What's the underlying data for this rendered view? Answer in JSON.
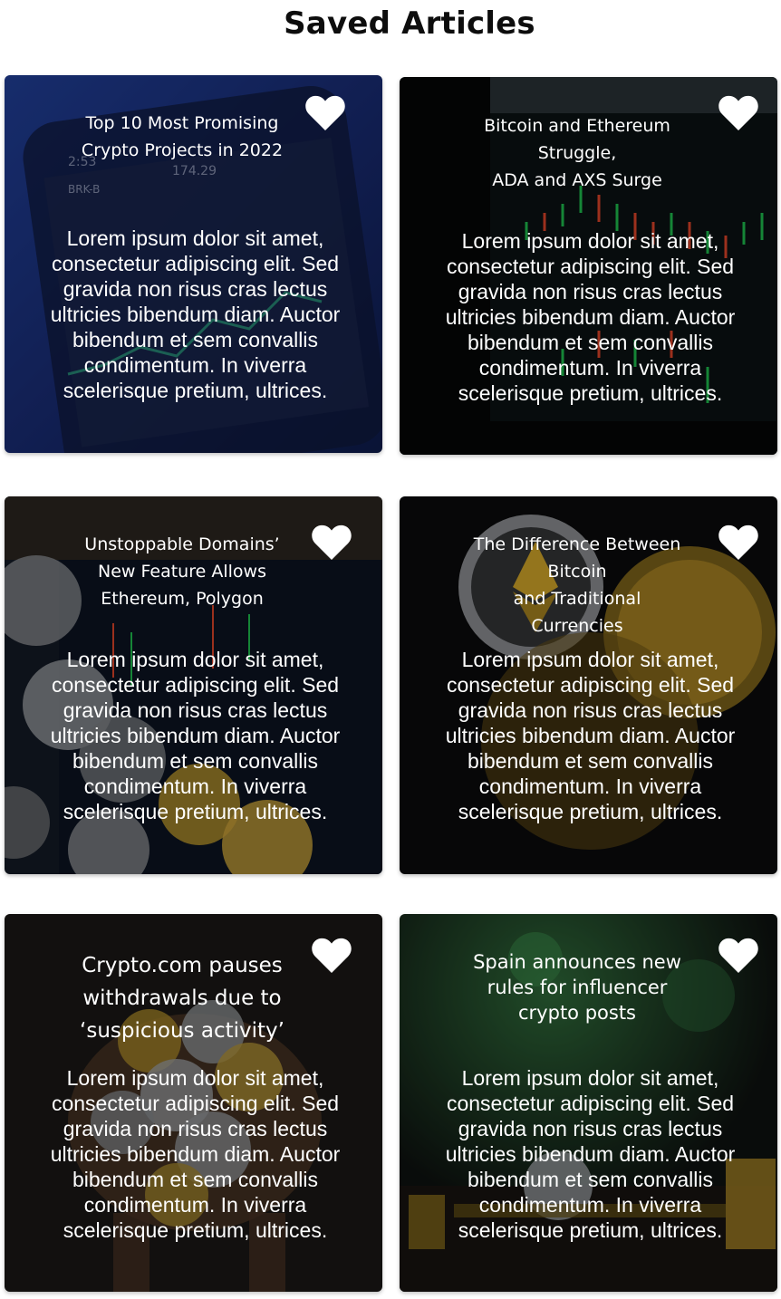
{
  "page": {
    "title": "Saved Articles"
  },
  "articles": [
    {
      "title": "Top 10 Most Promising\nCrypto Projects in 2022",
      "body": "Lorem ipsum dolor sit amet, consectetur adipiscing elit. Sed gravida non risus cras lectus ultricies bibendum diam. Auctor bibendum et sem convallis condimentum. In viverra scelerisque pretium, ultrices.",
      "favorite_icon": "heart-icon",
      "image": "phone-stock-chart"
    },
    {
      "title": "Bitcoin and Ethereum\nStruggle,\nADA and AXS Surge",
      "body": "Lorem ipsum dolor sit amet, consectetur adipiscing elit. Sed gravida non risus cras lectus ultricies bibendum diam. Auctor bibendum et sem convallis condimentum. In viverra scelerisque pretium, ultrices.",
      "favorite_icon": "heart-icon",
      "image": "candlestick-chart-screen"
    },
    {
      "title": "Unstoppable Domains’\nNew Feature Allows\nEthereum, Polygon",
      "body": "Lorem ipsum dolor sit amet, consectetur adipiscing elit. Sed gravida non risus cras lectus ultricies bibendum diam. Auctor bibendum et sem convallis condimentum. In viverra scelerisque pretium, ultrices.",
      "favorite_icon": "heart-icon",
      "image": "crypto-coins-on-chart"
    },
    {
      "title": "The Difference Between\nBitcoin\nand Traditional\nCurrencies",
      "body": "Lorem ipsum dolor sit amet, consectetur adipiscing elit. Sed gravida non risus cras lectus ultricies bibendum diam. Auctor bibendum et sem convallis condimentum. In viverra scelerisque pretium, ultrices.",
      "favorite_icon": "heart-icon",
      "image": "ethereum-and-gold-coins"
    },
    {
      "title": "Crypto.com pauses\nwithdrawals due to\n‘suspicious activity’",
      "body": "Lorem ipsum dolor sit amet, consectetur adipiscing elit. Sed gravida non risus cras lectus ultricies bibendum diam. Auctor bibendum et sem convallis condimentum. In viverra scelerisque pretium, ultrices.",
      "favorite_icon": "heart-icon",
      "image": "hands-holding-coins"
    },
    {
      "title": "Spain announces new\nrules for influencer\ncrypto posts",
      "body": "Lorem ipsum dolor sit amet, consectetur adipiscing elit. Sed gravida non risus cras lectus ultricies bibendum diam. Auctor bibendum et sem convallis condimentum. In viverra scelerisque pretium, ultrices.",
      "favorite_icon": "heart-icon",
      "image": "coin-stacks-bokeh"
    }
  ],
  "colors": {
    "card1_bg": "#1c2a5e",
    "card2_bg": "#050607",
    "card3_bg": "#141a26",
    "card4_bg": "#0b0b0c",
    "card5_bg": "#1d1a17",
    "card6_bg": "#0e1210",
    "heart": "#ffffff",
    "title_text": "#0d0d0d"
  }
}
